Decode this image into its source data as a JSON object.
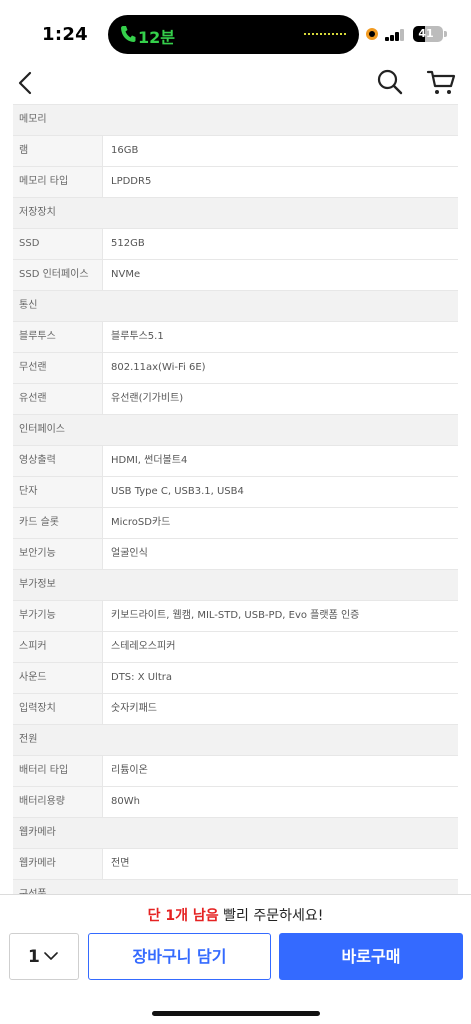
{
  "status_bar": {
    "time": "1:24",
    "call_timer": "12분",
    "battery_level": "41"
  },
  "nav": {
    "back_icon": "chevron-left-icon",
    "search_icon": "search-icon",
    "cart_icon": "cart-icon"
  },
  "specs": [
    {
      "type": "section",
      "label": "메모리"
    },
    {
      "type": "row",
      "key": "램",
      "value": "16GB"
    },
    {
      "type": "row",
      "key": "메모리 타입",
      "value": "LPDDR5"
    },
    {
      "type": "section",
      "label": "저장장치"
    },
    {
      "type": "row",
      "key": "SSD",
      "value": "512GB"
    },
    {
      "type": "row",
      "key": "SSD 인터페이스",
      "value": "NVMe"
    },
    {
      "type": "section",
      "label": "통신"
    },
    {
      "type": "row",
      "key": "블루투스",
      "value": "블루투스5.1"
    },
    {
      "type": "row",
      "key": "무선랜",
      "value": "802.11ax(Wi-Fi 6E)"
    },
    {
      "type": "row",
      "key": "유선랜",
      "value": "유선랜(기가비트)"
    },
    {
      "type": "section",
      "label": "인터페이스"
    },
    {
      "type": "row",
      "key": "영상출력",
      "value": "HDMI, 썬더볼트4"
    },
    {
      "type": "row",
      "key": "단자",
      "value": "USB Type C, USB3.1, USB4"
    },
    {
      "type": "row",
      "key": "카드 슬롯",
      "value": "MicroSD카드"
    },
    {
      "type": "row",
      "key": "보안기능",
      "value": "얼굴인식"
    },
    {
      "type": "section",
      "label": "부가정보"
    },
    {
      "type": "row",
      "key": "부가기능",
      "value": "키보드라이트, 웹캠, MIL-STD, USB-PD, Evo 플랫폼 인증"
    },
    {
      "type": "row",
      "key": "스피커",
      "value": "스테레오스피커"
    },
    {
      "type": "row",
      "key": "사운드",
      "value": "DTS: X Ultra"
    },
    {
      "type": "row",
      "key": "입력장치",
      "value": "숫자키패드"
    },
    {
      "type": "section",
      "label": "전원"
    },
    {
      "type": "row",
      "key": "배터리 타입",
      "value": "리튬이온"
    },
    {
      "type": "row",
      "key": "배터리용량",
      "value": "80Wh"
    },
    {
      "type": "section",
      "label": "웹카메라"
    },
    {
      "type": "row",
      "key": "웹카메라",
      "value": "전면"
    },
    {
      "type": "section",
      "label": "구성품"
    }
  ],
  "bottom": {
    "stock_highlight": "단 1개 남음",
    "stock_rest": " 빨리 주문하세요!",
    "quantity": "1",
    "cart_label": "장바구니 담기",
    "buy_label": "바로구매"
  },
  "colors": {
    "accent": "#346aff",
    "alert": "#e52222"
  }
}
